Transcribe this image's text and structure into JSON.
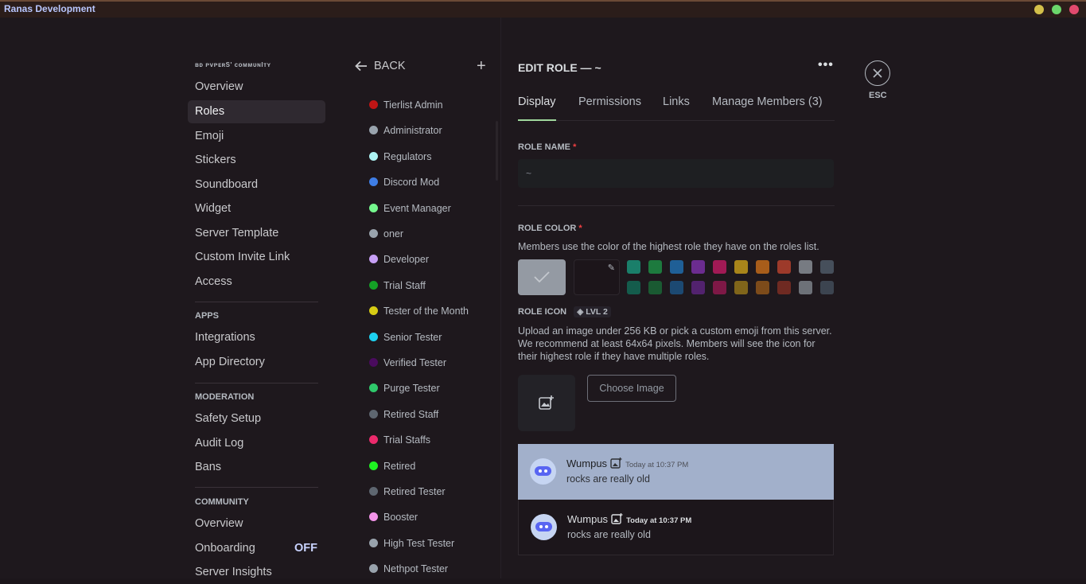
{
  "window": {
    "title": "Ranas Development",
    "dots": [
      "#d4c04a",
      "#6bd66b",
      "#e24a6e"
    ]
  },
  "nav": {
    "server_name": "ʙᴅ ᴘᴠᴘᴇʀS' ᴄᴏᴍᴍᴜɴIᴛʏ",
    "items": [
      "Overview",
      "Roles",
      "Emoji",
      "Stickers",
      "Soundboard",
      "Widget",
      "Server Template",
      "Custom Invite Link",
      "Access"
    ],
    "active": "Roles",
    "apps_header": "APPS",
    "apps": [
      "Integrations",
      "App Directory"
    ],
    "moderation_header": "MODERATION",
    "moderation": [
      "Safety Setup",
      "Audit Log",
      "Bans"
    ],
    "community_header": "COMMUNITY",
    "community": [
      "Overview",
      "Onboarding",
      "Server Insights"
    ],
    "onboarding_status": "OFF"
  },
  "roles_panel": {
    "back_label": "BACK",
    "roles": [
      {
        "name": "Tierlist Admin",
        "color": "#c01515"
      },
      {
        "name": "Administrator",
        "color": "#99a3ad"
      },
      {
        "name": "Regulators",
        "color": "#aef4f4"
      },
      {
        "name": "Discord Mod",
        "color": "#3f7ee6"
      },
      {
        "name": "Event Manager",
        "color": "#75f78e"
      },
      {
        "name": "oner",
        "color": "#99a3ad"
      },
      {
        "name": "Developer",
        "color": "#c79ff5"
      },
      {
        "name": "Trial Staff",
        "color": "#14a026"
      },
      {
        "name": "Tester of the Month",
        "color": "#d7cc14"
      },
      {
        "name": "Senior Tester",
        "color": "#1dd1f0"
      },
      {
        "name": "Verified Tester",
        "color": "#4a0b5e"
      },
      {
        "name": "Purge Tester",
        "color": "#2fc86b"
      },
      {
        "name": "Retired Staff",
        "color": "#5e6670"
      },
      {
        "name": "Trial Staffs",
        "color": "#ec2a6c"
      },
      {
        "name": "Retired",
        "color": "#1ef221"
      },
      {
        "name": "Retired Tester",
        "color": "#5e6670"
      },
      {
        "name": "Booster",
        "color": "#f394e9"
      },
      {
        "name": "High Test Tester",
        "color": "#99a3ad"
      },
      {
        "name": "Nethpot Tester",
        "color": "#99a3ad"
      }
    ]
  },
  "edit_role": {
    "heading": "EDIT ROLE — ~",
    "tabs": [
      "Display",
      "Permissions",
      "Links",
      "Manage Members (3)"
    ],
    "active_tab": "Display",
    "role_name_label": "ROLE NAME",
    "role_name_value": "~",
    "required_mark": "*",
    "role_color_label": "ROLE COLOR",
    "role_color_desc": "Members use the color of the highest role they have on the roles list.",
    "default_color": "#949aa3",
    "swatches_top": [
      "#1a7f6a",
      "#1d7a3e",
      "#1f5f96",
      "#6b2c8f",
      "#a11a55",
      "#a9851a",
      "#a85d1a",
      "#9d3a2a",
      "#777b82",
      "#464f5b"
    ],
    "swatches_bottom": [
      "#145c4c",
      "#1a5a32",
      "#1c4972",
      "#52226e",
      "#7e1846",
      "#80651a",
      "#7d4b1a",
      "#6f2a22",
      "#6d7178",
      "#3c4450"
    ],
    "role_icon_label": "ROLE ICON",
    "lvl_badge": "LVL 2",
    "role_icon_desc": "Upload an image under 256 KB or pick a custom emoji from this server. We recommend at least 64x64 pixels. Members will see the icon for their highest role if they have multiple roles.",
    "choose_image": "Choose Image",
    "preview": [
      {
        "name": "Wumpus",
        "time": "Today at 10:37 PM",
        "message": "rocks are really old"
      },
      {
        "name": "Wumpus",
        "time": "Today at 10:37 PM",
        "message": "rocks are really old"
      }
    ]
  },
  "close": {
    "label": "ESC"
  }
}
